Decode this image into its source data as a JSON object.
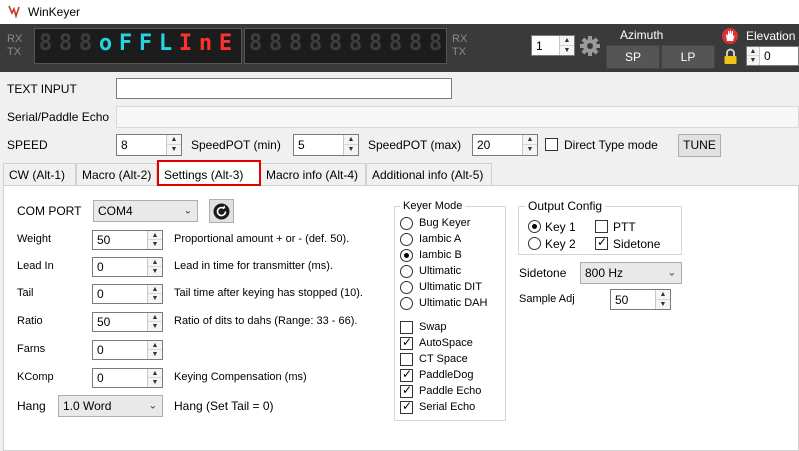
{
  "window": {
    "title": "WinKeyer"
  },
  "header": {
    "rx_label": "RX",
    "tx_label": "TX",
    "display_chars": [
      "8",
      "8",
      "8",
      "o",
      "F",
      "F",
      "L",
      "I",
      "n",
      "E",
      "8",
      "8",
      "8",
      "8",
      "8",
      "8",
      "8",
      "8",
      "8",
      "8"
    ],
    "channel_value": "1",
    "azimuth_label": "Azimuth",
    "sp_label": "SP",
    "lp_label": "LP",
    "elevation_label": "Elevation",
    "elevation_value": "0"
  },
  "io": {
    "text_input_label": "TEXT INPUT",
    "text_input_value": "",
    "echo_label": "Serial/Paddle Echo",
    "echo_value": ""
  },
  "speed": {
    "speed_label": "SPEED",
    "speed_value": "8",
    "min_label": "SpeedPOT (min)",
    "min_value": "5",
    "max_label": "SpeedPOT (max)",
    "max_value": "20",
    "direct_label": "Direct Type mode",
    "tune_label": "TUNE"
  },
  "tabs": [
    {
      "label": "CW (Alt-1)"
    },
    {
      "label": "Macro (Alt-2)"
    },
    {
      "label": "Settings (Alt-3)"
    },
    {
      "label": "Macro info (Alt-4)"
    },
    {
      "label": "Additional info (Alt-5)"
    }
  ],
  "settings": {
    "com_port_label": "COM PORT",
    "com_port_value": "COM4",
    "rows": [
      {
        "label": "Weight",
        "value": "50",
        "desc": "Proportional amount + or - (def. 50)."
      },
      {
        "label": "Lead In",
        "value": "0",
        "desc": "Lead in time for transmitter (ms)."
      },
      {
        "label": "Tail",
        "value": "0",
        "desc": "Tail time after keying has stopped (10)."
      },
      {
        "label": "Ratio",
        "value": "50",
        "desc": "Ratio of dits to dahs (Range: 33 - 66)."
      },
      {
        "label": "Farns",
        "value": "0",
        "desc": ""
      },
      {
        "label": "KComp",
        "value": "0",
        "desc": "Keying Compensation (ms)"
      }
    ],
    "hang_label": "Hang",
    "hang_value": "1.0 Word",
    "hang_desc": "Hang (Set Tail = 0)",
    "keyer_mode": {
      "title": "Keyer Mode",
      "modes": [
        {
          "label": "Bug Keyer",
          "checked": false
        },
        {
          "label": "Iambic A",
          "checked": false
        },
        {
          "label": "Iambic B",
          "checked": true
        },
        {
          "label": "Ultimatic",
          "checked": false
        },
        {
          "label": "Ultimatic DIT",
          "checked": false
        },
        {
          "label": "Ultimatic DAH",
          "checked": false
        }
      ],
      "options": [
        {
          "label": "Swap",
          "checked": false
        },
        {
          "label": "AutoSpace",
          "checked": true
        },
        {
          "label": "CT Space",
          "checked": false
        },
        {
          "label": "PaddleDog",
          "checked": true
        },
        {
          "label": "Paddle Echo",
          "checked": true
        },
        {
          "label": "Serial Echo",
          "checked": true
        }
      ]
    },
    "output_config": {
      "title": "Output Config",
      "key1": "Key 1",
      "key2": "Key 2",
      "ptt": "PTT",
      "sidetone": "Sidetone"
    },
    "sidetone_label": "Sidetone",
    "sidetone_value": "800 Hz",
    "sample_adj_label": "Sample Adj",
    "sample_adj_value": "50"
  },
  "colors": {
    "accent_red": "#e00000",
    "led_cyan": "#27d3e3",
    "led_red": "#ff3030"
  }
}
